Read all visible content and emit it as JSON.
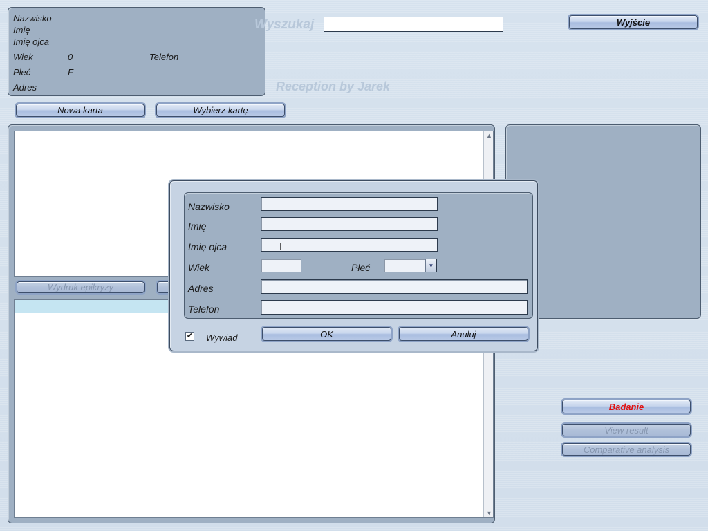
{
  "header": {
    "search_label": "Wyszukaj",
    "search_value": "",
    "exit_label": "Wyjście",
    "watermark": "Reception by Jarek"
  },
  "patient_info": {
    "surname_label": "Nazwisko",
    "name_label": "Imię",
    "father_name_label": "Imię ojca",
    "age_label": "Wiek",
    "age_value": "0",
    "phone_label": "Telefon",
    "sex_label": "Płeć",
    "sex_value": "F",
    "address_label": "Adres"
  },
  "card_actions": {
    "new_card_label": "Nowa karta",
    "choose_card_label": "Wybierz kartę"
  },
  "middle_actions": {
    "print_epicrisis_label": "Wydruk epikryzy"
  },
  "right_actions": {
    "exam_label": "Badanie",
    "exam_color": "#e01010",
    "view_result_label": "View result",
    "comparative_label": "Comparative analysis"
  },
  "dialog": {
    "surname_label": "Nazwisko",
    "surname_value": "",
    "name_label": "Imię",
    "name_value": "",
    "father_name_label": "Imię ojca",
    "father_name_value": "",
    "age_label": "Wiek",
    "age_value": "",
    "sex_label": "Płeć",
    "sex_value": "",
    "address_label": "Adres",
    "address_value": "",
    "phone_label": "Telefon",
    "phone_value": "",
    "interview_label": "Wywiad",
    "interview_checked": true,
    "ok_label": "OK",
    "cancel_label": "Anuluj"
  }
}
